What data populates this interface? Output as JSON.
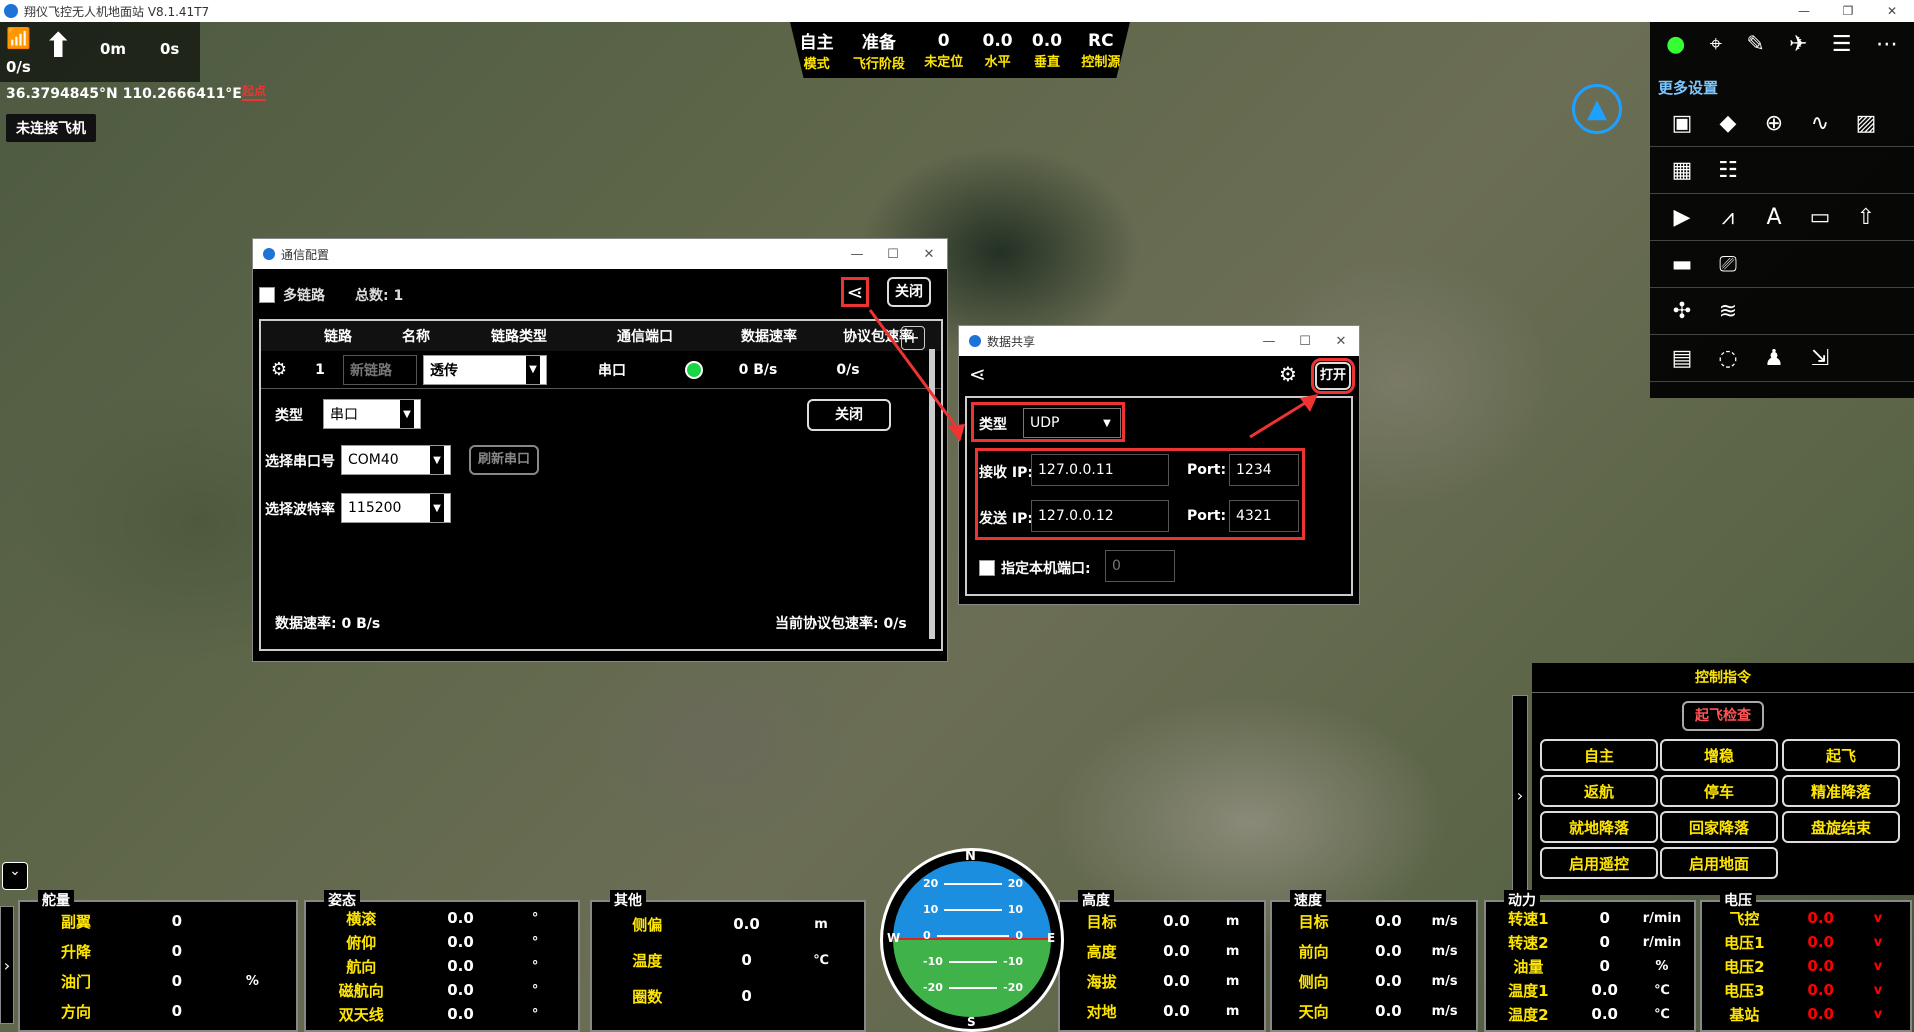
{
  "app": {
    "title": "翔仪飞控无人机地面站 V8.1.41T7",
    "win_min": "—",
    "win_max": "❐",
    "win_close": "✕"
  },
  "hud": {
    "speed": "0/s",
    "dist": "0m",
    "time": "0s",
    "gps": "36.3794845°N 110.2666411°E",
    "connect": "未连接飞机",
    "redflag": "起点"
  },
  "status": [
    {
      "v": "自主",
      "l": "模式"
    },
    {
      "v": "准备",
      "l": "飞行阶段"
    },
    {
      "v": "0",
      "l": "未定位"
    },
    {
      "v": "0.0",
      "l": "水平"
    },
    {
      "v": "0.0",
      "l": "垂直"
    },
    {
      "v": "RC",
      "l": "控制源"
    }
  ],
  "toolbar": {
    "more": "更多设置",
    "icons": [
      "drone-map-icon",
      "map-pin-icon",
      "pen-icon",
      "plane-icon",
      "settings-slider-icon",
      "more-icon"
    ]
  },
  "comm": {
    "title": "通信配置",
    "multi": "多链路",
    "total": "总数: 1",
    "close": "关闭",
    "cols": [
      "链路",
      "名称",
      "链路类型",
      "通信端口",
      "数据速率",
      "协议包速率"
    ],
    "row": {
      "idx": "1",
      "name": "新链路",
      "type": "透传",
      "port": "串口",
      "rate": "0 B/s",
      "pkt": "0/s"
    },
    "type_label": "类型",
    "type_val": "串口",
    "close2": "关闭",
    "serial_label": "选择串口号",
    "serial_val": "COM40",
    "refresh": "刷新串口",
    "baud_label": "选择波特率",
    "baud_val": "115200",
    "data_rate": "数据速率: 0 B/s",
    "pkt_rate": "当前协议包速率: 0/s",
    "add": "+"
  },
  "share": {
    "title": "数据共享",
    "open": "打开",
    "type_label": "类型",
    "type_val": "UDP",
    "recv_label": "接收 IP:",
    "recv_ip": "127.0.0.11",
    "port_label": "Port:",
    "recv_port": "1234",
    "send_label": "发送 IP:",
    "send_ip": "127.0.0.12",
    "send_port": "4321",
    "local_label": "指定本机端口:",
    "local_port": "0"
  },
  "ctrl": {
    "title": "控制指令",
    "check": "起飞检查",
    "buttons": [
      "自主",
      "增稳",
      "起飞",
      "返航",
      "停车",
      "精准降落",
      "就地降落",
      "回家降落",
      "盘旋结束",
      "启用遥控",
      "启用地面"
    ]
  },
  "panels": {
    "power": {
      "title": "舵量",
      "rows": [
        {
          "k": "副翼",
          "v": "0",
          "u": ""
        },
        {
          "k": "升降",
          "v": "0",
          "u": ""
        },
        {
          "k": "油门",
          "v": "0",
          "u": "%"
        },
        {
          "k": "方向",
          "v": "0",
          "u": ""
        }
      ]
    },
    "attitude": {
      "title": "姿态",
      "rows": [
        {
          "k": "横滚",
          "v": "0.0",
          "u": "°"
        },
        {
          "k": "俯仰",
          "v": "0.0",
          "u": "°"
        },
        {
          "k": "航向",
          "v": "0.0",
          "u": "°"
        },
        {
          "k": "磁航向",
          "v": "0.0",
          "u": "°"
        },
        {
          "k": "双天线",
          "v": "0.0",
          "u": "°"
        }
      ]
    },
    "other": {
      "title": "其他",
      "rows": [
        {
          "k": "侧偏",
          "v": "0.0",
          "u": "m"
        },
        {
          "k": "温度",
          "v": "0",
          "u": "℃"
        },
        {
          "k": "圈数",
          "v": "0",
          "u": ""
        }
      ]
    },
    "alt": {
      "title": "高度",
      "rows": [
        {
          "k": "目标",
          "v": "0.0",
          "u": "m"
        },
        {
          "k": "高度",
          "v": "0.0",
          "u": "m"
        },
        {
          "k": "海拔",
          "v": "0.0",
          "u": "m"
        },
        {
          "k": "对地",
          "v": "0.0",
          "u": "m"
        }
      ]
    },
    "speed": {
      "title": "速度",
      "rows": [
        {
          "k": "目标",
          "v": "0.0",
          "u": "m/s"
        },
        {
          "k": "前向",
          "v": "0.0",
          "u": "m/s"
        },
        {
          "k": "侧向",
          "v": "0.0",
          "u": "m/s"
        },
        {
          "k": "天向",
          "v": "0.0",
          "u": "m/s"
        }
      ]
    },
    "dyn": {
      "title": "动力",
      "rows": [
        {
          "k": "转速1",
          "v": "0",
          "u": "r/min"
        },
        {
          "k": "转速2",
          "v": "0",
          "u": "r/min"
        },
        {
          "k": "油量",
          "v": "0",
          "u": "%"
        },
        {
          "k": "温度1",
          "v": "0.0",
          "u": "℃"
        },
        {
          "k": "温度2",
          "v": "0.0",
          "u": "℃"
        }
      ]
    },
    "volt": {
      "title": "电压",
      "rows": [
        {
          "k": "飞控",
          "v": "0.0",
          "u": "v"
        },
        {
          "k": "电压1",
          "v": "0.0",
          "u": "v"
        },
        {
          "k": "电压2",
          "v": "0.0",
          "u": "v"
        },
        {
          "k": "电压3",
          "v": "0.0",
          "u": "v"
        },
        {
          "k": "基站",
          "v": "0.0",
          "u": "v"
        }
      ]
    }
  },
  "horizon": {
    "top": "N",
    "e": "E",
    "w": "W",
    "s": "S",
    "ticks": [
      "20",
      "10",
      "0",
      "-10",
      "-20"
    ]
  }
}
